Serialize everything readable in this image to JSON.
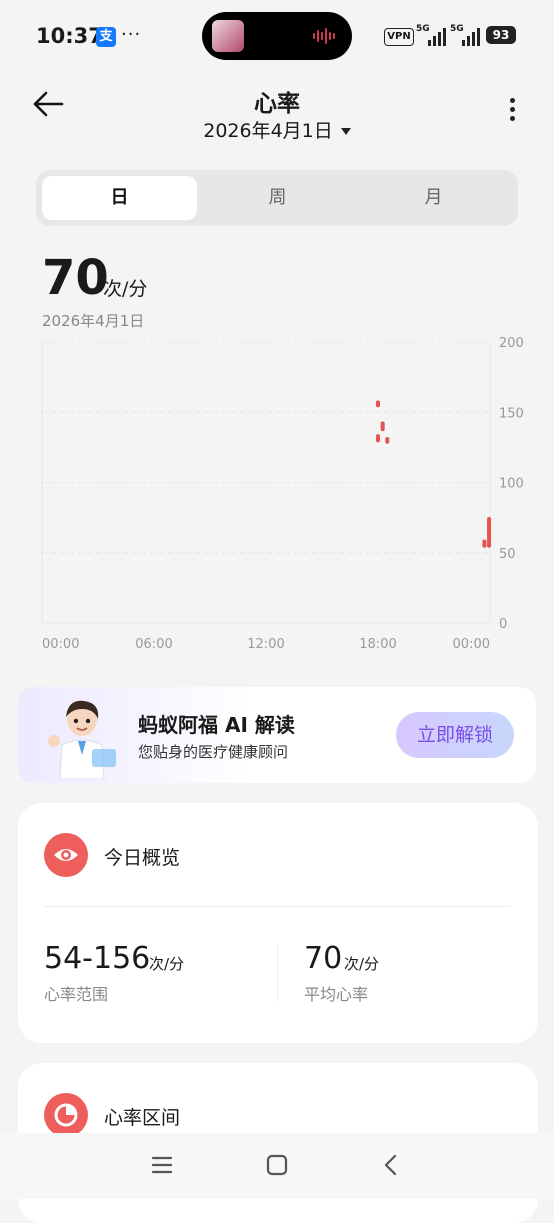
{
  "status_bar": {
    "time": "10:37",
    "alipay_glyph": "支",
    "more_glyph": "···",
    "vpn": "VPN",
    "signal1": "5G",
    "signal2": "5G",
    "battery": "93"
  },
  "header": {
    "title": "心率",
    "date": "2026年4月1日"
  },
  "tabs": [
    {
      "label": "日",
      "active": true
    },
    {
      "label": "周",
      "active": false
    },
    {
      "label": "月",
      "active": false
    }
  ],
  "summary": {
    "value": "70",
    "unit": "次/分",
    "date": "2026年4月1日"
  },
  "chart_data": {
    "type": "scatter",
    "x_ticks": [
      "00:00",
      "06:00",
      "12:00",
      "18:00",
      "00:00"
    ],
    "y_ticks": [
      0,
      50,
      100,
      150,
      200
    ],
    "ylim": [
      0,
      200
    ],
    "xlim_hours": [
      0,
      24
    ],
    "color": "#e55451",
    "points": [
      {
        "hour": 18.0,
        "low": 155,
        "high": 157
      },
      {
        "hour": 18.0,
        "low": 130,
        "high": 133
      },
      {
        "hour": 18.25,
        "low": 138,
        "high": 142
      },
      {
        "hour": 18.5,
        "low": 129,
        "high": 131
      },
      {
        "hour": 23.7,
        "low": 55,
        "high": 58
      },
      {
        "hour": 23.95,
        "low": 55,
        "high": 74
      }
    ]
  },
  "ai_card": {
    "title": "蚂蚁阿福 AI 解读",
    "subtitle": "您贴身的医疗健康顾问",
    "button": "立即解锁"
  },
  "overview": {
    "title": "今日概览",
    "range_value": "54-156",
    "range_unit": "次/分",
    "range_label": "心率范围",
    "avg_value": "70",
    "avg_unit": "次/分",
    "avg_label": "平均心率"
  },
  "zones": {
    "title": "心率区间"
  },
  "colors": {
    "accent": "#e55451",
    "background": "#f4f4f4"
  }
}
